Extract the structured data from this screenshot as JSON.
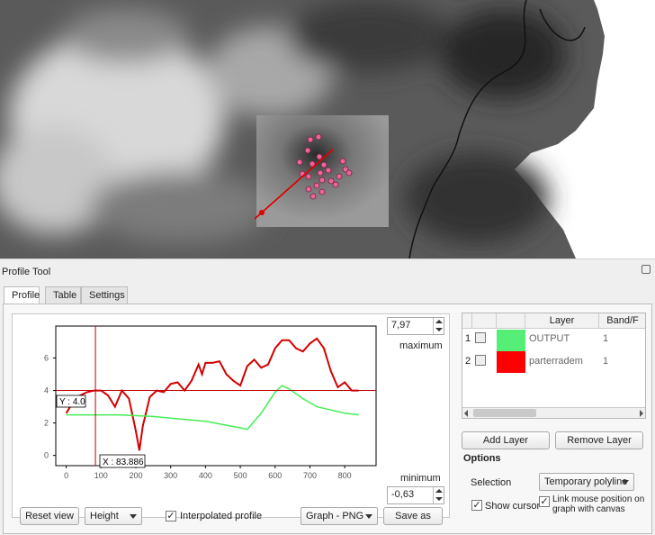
{
  "dock": {
    "title": "Profile Tool"
  },
  "tabs": [
    {
      "label": "Profile"
    },
    {
      "label": "Table"
    },
    {
      "label": "Settings"
    }
  ],
  "graph": {
    "max_value": "7,97",
    "max_label": "maximum",
    "min_value": "-0,63",
    "min_label": "minimum",
    "y_cursor_label": "Y : 4.0",
    "x_cursor_label": "X : 83.886",
    "y_ticks": [
      "0",
      "2",
      "4",
      "6"
    ],
    "x_ticks": [
      "0",
      "100",
      "200",
      "300",
      "400",
      "500",
      "600",
      "700",
      "800"
    ]
  },
  "chart_data": {
    "type": "line",
    "x_range": [
      -30,
      890
    ],
    "y_range": [
      -0.63,
      7.97
    ],
    "cursor": {
      "x": 83.886,
      "y": 4.0
    },
    "series": [
      {
        "color": "#d40000",
        "x": [
          0,
          20,
          40,
          60,
          80,
          100,
          120,
          140,
          160,
          180,
          200,
          210,
          220,
          240,
          260,
          280,
          300,
          320,
          340,
          360,
          380,
          390,
          400,
          420,
          440,
          460,
          480,
          500,
          520,
          540,
          560,
          580,
          600,
          620,
          640,
          660,
          680,
          700,
          720,
          740,
          760,
          780,
          800,
          820,
          840
        ],
        "y": [
          2.6,
          3.3,
          3.7,
          3.9,
          4.0,
          4.0,
          3.7,
          3.0,
          4.0,
          3.5,
          1.5,
          0.3,
          1.8,
          3.6,
          4.0,
          3.9,
          4.4,
          4.5,
          4.0,
          4.6,
          5.6,
          5.0,
          5.7,
          5.7,
          5.8,
          5.0,
          4.6,
          4.3,
          5.5,
          5.9,
          5.4,
          5.6,
          6.6,
          7.1,
          7.1,
          6.6,
          6.4,
          6.9,
          7.2,
          6.6,
          5.2,
          4.2,
          4.5,
          4.0,
          4.0
        ]
      },
      {
        "color": "#44ee55",
        "x": [
          0,
          50,
          100,
          150,
          200,
          250,
          300,
          350,
          400,
          450,
          500,
          520,
          560,
          600,
          620,
          640,
          680,
          720,
          760,
          800,
          840
        ],
        "y": [
          2.5,
          2.5,
          2.5,
          2.5,
          2.45,
          2.4,
          2.3,
          2.2,
          2.1,
          1.9,
          1.7,
          1.6,
          2.6,
          3.9,
          4.3,
          4.1,
          3.5,
          3.0,
          2.8,
          2.6,
          2.5
        ]
      }
    ]
  },
  "controls": {
    "reset_view": "Reset view",
    "height_combo": "Height",
    "interpolated_profile": "Interpolated profile",
    "graph_format": "Graph - PNG",
    "save_as": "Save as"
  },
  "layers": {
    "headers": [
      "Layer",
      "Band/F"
    ],
    "rows": [
      {
        "index": "1",
        "color": "#55ee77",
        "name": "OUTPUT",
        "band": "1"
      },
      {
        "index": "2",
        "color": "#ff0000",
        "name": "parterradem",
        "band": "1"
      }
    ],
    "add_layer": "Add Layer",
    "remove_layer": "Remove Layer"
  },
  "options": {
    "title": "Options",
    "selection_label": "Selection",
    "selection_value": "Temporary polyline",
    "show_cursor": "Show cursor",
    "link_mouse": "Link mouse position on graph with canvas"
  }
}
